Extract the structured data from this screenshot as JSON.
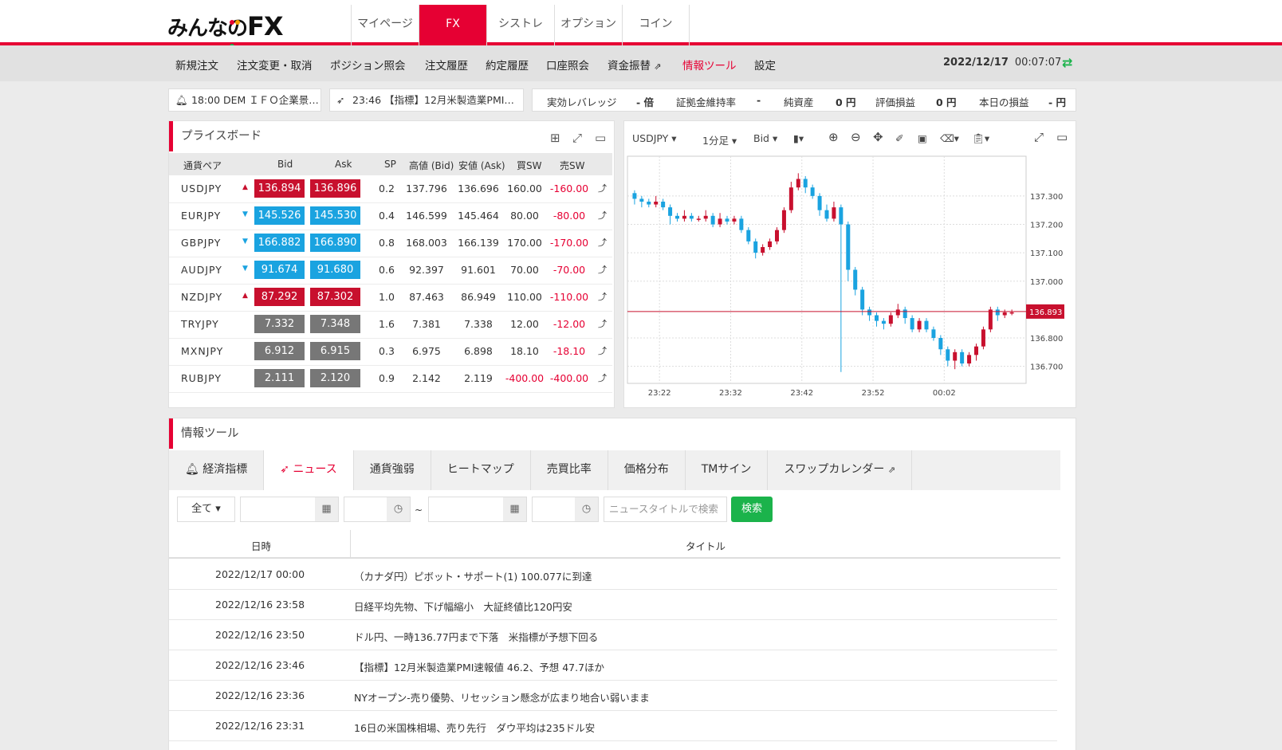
{
  "brand": {
    "logo_text": "みんなの",
    "logo_fx": "FX"
  },
  "top_tabs": [
    "マイページ",
    "FX",
    "シストレ",
    "オプション",
    "コイン"
  ],
  "sub_nav": [
    "新規注文",
    "注文変更・取消",
    "ポジション照会",
    "注文履歴",
    "約定履歴",
    "口座照会",
    "資金振替",
    "情報ツール",
    "設定"
  ],
  "clock": {
    "date": "2022/12/17",
    "time": "00:07:07"
  },
  "tickers": [
    "18:00 DEM ＩＦＯ企業景…",
    "23:46 【指標】12月米製造業PMI…"
  ],
  "account": {
    "leverage_label": "実効レバレッジ",
    "leverage_value": "- 倍",
    "margin_label": "証拠金維持率",
    "margin_value": "-",
    "net_label": "純資産",
    "net_value": "0 円",
    "pl_label": "評価損益",
    "pl_value": "0 円",
    "today_label": "本日の損益",
    "today_value": "- 円"
  },
  "priceboard": {
    "title": "プライスボード",
    "headers": [
      "通貨ペア",
      "Bid",
      "Ask",
      "SP",
      "高値 (Bid)",
      "安値 (Ask)",
      "買SW",
      "売SW"
    ],
    "rows": [
      {
        "pair": "USDJPY",
        "dir": "up",
        "bid": "136.894",
        "ask": "136.896",
        "sp": "0.2",
        "high": "137.796",
        "low": "136.696",
        "buy": "160.00",
        "sell": "-160.00",
        "color": "red"
      },
      {
        "pair": "EURJPY",
        "dir": "down",
        "bid": "145.526",
        "ask": "145.530",
        "sp": "0.4",
        "high": "146.599",
        "low": "145.464",
        "buy": "80.00",
        "sell": "-80.00",
        "color": "blue"
      },
      {
        "pair": "GBPJPY",
        "dir": "down",
        "bid": "166.882",
        "ask": "166.890",
        "sp": "0.8",
        "high": "168.003",
        "low": "166.139",
        "buy": "170.00",
        "sell": "-170.00",
        "color": "blue"
      },
      {
        "pair": "AUDJPY",
        "dir": "down",
        "bid": "91.674",
        "ask": "91.680",
        "sp": "0.6",
        "high": "92.397",
        "low": "91.601",
        "buy": "70.00",
        "sell": "-70.00",
        "color": "blue"
      },
      {
        "pair": "NZDJPY",
        "dir": "up",
        "bid": "87.292",
        "ask": "87.302",
        "sp": "1.0",
        "high": "87.463",
        "low": "86.949",
        "buy": "110.00",
        "sell": "-110.00",
        "color": "red"
      },
      {
        "pair": "TRYJPY",
        "dir": "none",
        "bid": "7.332",
        "ask": "7.348",
        "sp": "1.6",
        "high": "7.381",
        "low": "7.338",
        "buy": "12.00",
        "sell": "-12.00",
        "color": "gray"
      },
      {
        "pair": "MXNJPY",
        "dir": "none",
        "bid": "6.912",
        "ask": "6.915",
        "sp": "0.3",
        "high": "6.975",
        "low": "6.898",
        "buy": "18.10",
        "sell": "-18.10",
        "color": "gray"
      },
      {
        "pair": "RUBJPY",
        "dir": "none",
        "bid": "2.111",
        "ask": "2.120",
        "sp": "0.9",
        "high": "2.142",
        "low": "2.119",
        "buy": "-400.00",
        "sell": "-400.00",
        "color": "gray"
      }
    ]
  },
  "chart_toolbar": {
    "symbol": "USDJPY",
    "timeframe": "1分足",
    "side": "Bid"
  },
  "chart_data": {
    "type": "candlestick",
    "x": [
      "23:22",
      "23:32",
      "23:42",
      "23:52",
      "00:02"
    ],
    "y_ticks": [
      "137.300",
      "137.200",
      "137.100",
      "137.000",
      "136.800",
      "136.700"
    ],
    "ylim": [
      136.64,
      137.44
    ],
    "current_price": "136.893",
    "candles": [
      [
        137.31,
        137.29,
        137.32,
        137.27
      ],
      [
        137.29,
        137.28,
        137.3,
        137.26
      ],
      [
        137.28,
        137.27,
        137.29,
        137.26
      ],
      [
        137.27,
        137.28,
        137.3,
        137.26
      ],
      [
        137.28,
        137.26,
        137.29,
        137.25
      ],
      [
        137.26,
        137.23,
        137.27,
        137.2
      ],
      [
        137.23,
        137.22,
        137.24,
        137.21
      ],
      [
        137.22,
        137.23,
        137.25,
        137.21
      ],
      [
        137.23,
        137.22,
        137.24,
        137.21
      ],
      [
        137.22,
        137.22,
        137.23,
        137.21
      ],
      [
        137.22,
        137.23,
        137.25,
        137.21
      ],
      [
        137.23,
        137.2,
        137.24,
        137.19
      ],
      [
        137.2,
        137.22,
        137.24,
        137.19
      ],
      [
        137.22,
        137.21,
        137.23,
        137.2
      ],
      [
        137.21,
        137.22,
        137.23,
        137.2
      ],
      [
        137.22,
        137.18,
        137.23,
        137.17
      ],
      [
        137.18,
        137.14,
        137.19,
        137.13
      ],
      [
        137.14,
        137.1,
        137.15,
        137.08
      ],
      [
        137.1,
        137.12,
        137.13,
        137.09
      ],
      [
        137.12,
        137.14,
        137.15,
        137.11
      ],
      [
        137.14,
        137.18,
        137.19,
        137.13
      ],
      [
        137.18,
        137.25,
        137.26,
        137.17
      ],
      [
        137.25,
        137.33,
        137.35,
        137.24
      ],
      [
        137.33,
        137.36,
        137.38,
        137.32
      ],
      [
        137.36,
        137.33,
        137.37,
        137.31
      ],
      [
        137.33,
        137.3,
        137.34,
        137.29
      ],
      [
        137.3,
        137.25,
        137.31,
        137.23
      ],
      [
        137.25,
        137.22,
        137.27,
        137.21
      ],
      [
        137.22,
        137.26,
        137.28,
        137.21
      ],
      [
        137.26,
        137.2,
        137.27,
        136.68
      ],
      [
        137.2,
        137.04,
        137.21,
        137.0
      ],
      [
        137.04,
        136.97,
        137.05,
        136.95
      ],
      [
        136.97,
        136.9,
        136.98,
        136.88
      ],
      [
        136.9,
        136.88,
        136.91,
        136.86
      ],
      [
        136.88,
        136.86,
        136.89,
        136.84
      ],
      [
        136.86,
        136.85,
        136.87,
        136.83
      ],
      [
        136.85,
        136.88,
        136.89,
        136.84
      ],
      [
        136.88,
        136.9,
        136.92,
        136.87
      ],
      [
        136.9,
        136.87,
        136.91,
        136.85
      ],
      [
        136.87,
        136.83,
        136.88,
        136.82
      ],
      [
        136.83,
        136.86,
        136.87,
        136.82
      ],
      [
        136.86,
        136.83,
        136.87,
        136.82
      ],
      [
        136.83,
        136.8,
        136.84,
        136.79
      ],
      [
        136.8,
        136.76,
        136.81,
        136.74
      ],
      [
        136.76,
        136.72,
        136.77,
        136.7
      ],
      [
        136.72,
        136.75,
        136.76,
        136.69
      ],
      [
        136.75,
        136.71,
        136.76,
        136.7
      ],
      [
        136.71,
        136.74,
        136.75,
        136.7
      ],
      [
        136.74,
        136.77,
        136.78,
        136.72
      ],
      [
        136.77,
        136.83,
        136.84,
        136.76
      ],
      [
        136.83,
        136.9,
        136.91,
        136.82
      ],
      [
        136.9,
        136.88,
        136.91,
        136.86
      ],
      [
        136.88,
        136.89,
        136.9,
        136.87
      ],
      [
        136.89,
        136.89,
        136.9,
        136.88
      ]
    ]
  },
  "info": {
    "title": "情報ツール",
    "tabs": [
      "経済指標",
      "ニュース",
      "通貨強弱",
      "ヒートマップ",
      "売買比率",
      "価格分布",
      "TMサイン",
      "スワップカレンダー"
    ],
    "filter_all": "全て",
    "search_placeholder": "ニュースタイトルで検索",
    "search_button": "検索",
    "tilde": "~",
    "col_date": "日時",
    "col_title": "タイトル",
    "news": [
      {
        "date": "2022/12/17 00:00",
        "title": "（カナダ円）ピボット・サポート(1) 100.077に到達"
      },
      {
        "date": "2022/12/16 23:58",
        "title": "日経平均先物、下げ幅縮小　大証終値比120円安"
      },
      {
        "date": "2022/12/16 23:50",
        "title": "ドル円、一時136.77円まで下落　米指標が予想下回る"
      },
      {
        "date": "2022/12/16 23:46",
        "title": "【指標】12月米製造業PMI速報値 46.2、予想 47.7ほか"
      },
      {
        "date": "2022/12/16 23:36",
        "title": "NYオープン-売り優勢、リセッション懸念が広まり地合い弱いまま"
      },
      {
        "date": "2022/12/16 23:31",
        "title": "16日の米国株相場、売り先行　ダウ平均は235ドル安"
      }
    ]
  },
  "colors": {
    "brand_red": "#e60033",
    "up_red": "#c8102e",
    "down_blue": "#1aa3e0",
    "green": "#1bb34b"
  }
}
